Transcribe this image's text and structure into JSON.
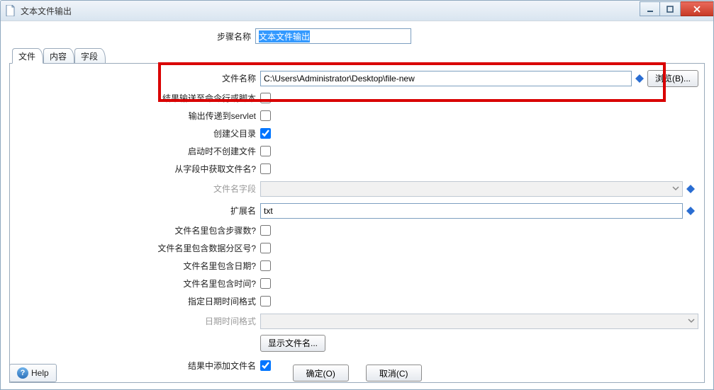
{
  "window": {
    "title": "文本文件输出"
  },
  "header": {
    "step_name_label": "步骤名称",
    "step_name_value": "文本文件输出"
  },
  "tabs": {
    "file": "文件",
    "content": "内容",
    "fields": "字段"
  },
  "form": {
    "file_name_label": "文件名称",
    "file_name_value": "C:\\Users\\Administrator\\Desktop\\file-new",
    "browse_label": "浏览(B)...",
    "run_as_cmd_label": "结果输送至命令行或脚本",
    "output_servlet_label": "输出传递到servlet",
    "create_parent_label": "创建父目录",
    "no_create_on_start_label": "启动时不创建文件",
    "filename_from_field_label": "从字段中获取文件名?",
    "filename_field_label": "文件名字段",
    "extension_label": "扩展名",
    "extension_value": "txt",
    "include_stepnr_label": "文件名里包含步骤数?",
    "include_partition_label": "文件名里包含数据分区号?",
    "include_date_label": "文件名里包含日期?",
    "include_time_label": "文件名里包含时间?",
    "specify_fmt_label": "指定日期时间格式",
    "datetime_fmt_label": "日期时间格式",
    "show_filenames_label": "显示文件名...",
    "add_to_result_label": "结果中添加文件名"
  },
  "checks": {
    "run_as_cmd": false,
    "output_servlet": false,
    "create_parent": true,
    "no_create_on_start": false,
    "filename_from_field": false,
    "include_stepnr": false,
    "include_partition": false,
    "include_date": false,
    "include_time": false,
    "specify_fmt": false,
    "add_to_result": true
  },
  "footer": {
    "help": "Help",
    "ok": "确定(O)",
    "cancel": "取消(C)"
  },
  "icons": {
    "doc": "document-icon",
    "min": "minimize-icon",
    "max": "maximize-icon",
    "close": "close-icon",
    "diamond": "variable-diamond-icon",
    "arrow": "chevron-down-icon"
  }
}
